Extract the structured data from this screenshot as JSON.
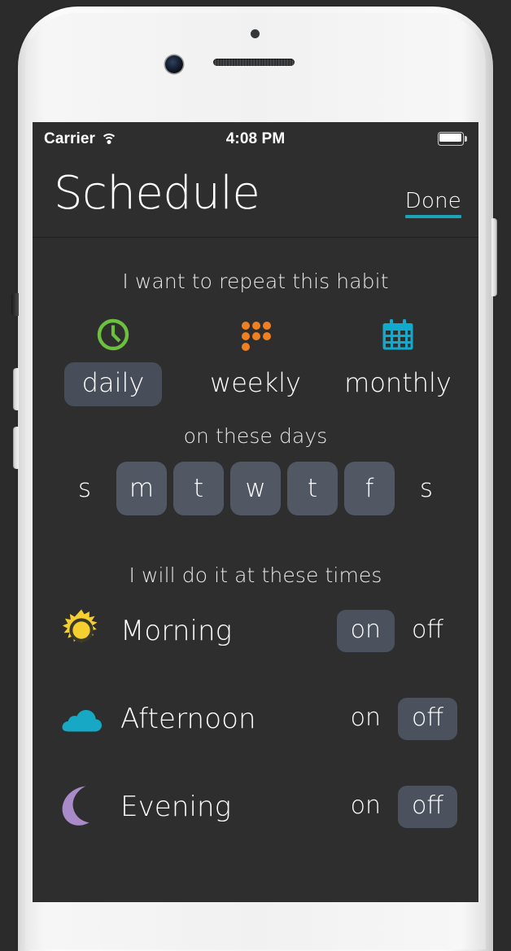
{
  "status_bar": {
    "carrier": "Carrier",
    "time": "4:08 PM",
    "wifi_icon": "wifi-icon",
    "battery_icon": "battery-full-icon"
  },
  "nav": {
    "title": "Schedule",
    "done_label": "Done",
    "accent_color": "#1ba4b8"
  },
  "sections": {
    "repeat_label": "I want to repeat this habit",
    "days_label": "on these days",
    "times_label": "I will do it at these times"
  },
  "frequency": {
    "selected": "daily",
    "options": [
      {
        "label": "daily",
        "icon": "clock-icon",
        "icon_color": "#6cbf3f",
        "selected": true
      },
      {
        "label": "weekly",
        "icon": "dots-grid-icon",
        "icon_color": "#ef8022",
        "selected": false
      },
      {
        "label": "monthly",
        "icon": "calendar-icon",
        "icon_color": "#11a9cc",
        "selected": false
      }
    ]
  },
  "days": [
    {
      "label": "s",
      "selected": false
    },
    {
      "label": "m",
      "selected": true
    },
    {
      "label": "t",
      "selected": true
    },
    {
      "label": "w",
      "selected": true
    },
    {
      "label": "t",
      "selected": true
    },
    {
      "label": "f",
      "selected": true
    },
    {
      "label": "s",
      "selected": false
    }
  ],
  "times": [
    {
      "name": "Morning",
      "icon": "sun-icon",
      "icon_color": "#f5cf2e",
      "on_label": "on",
      "off_label": "off",
      "value": "on"
    },
    {
      "name": "Afternoon",
      "icon": "cloud-icon",
      "icon_color": "#16a8c4",
      "on_label": "on",
      "off_label": "off",
      "value": "off"
    },
    {
      "name": "Evening",
      "icon": "moon-icon",
      "icon_color": "#a98bc9",
      "on_label": "on",
      "off_label": "off",
      "value": "off"
    }
  ],
  "theme": {
    "screen_bg": "#2e2e2e",
    "pill_selected_bg": "#474e59",
    "text": "#ffffff"
  }
}
